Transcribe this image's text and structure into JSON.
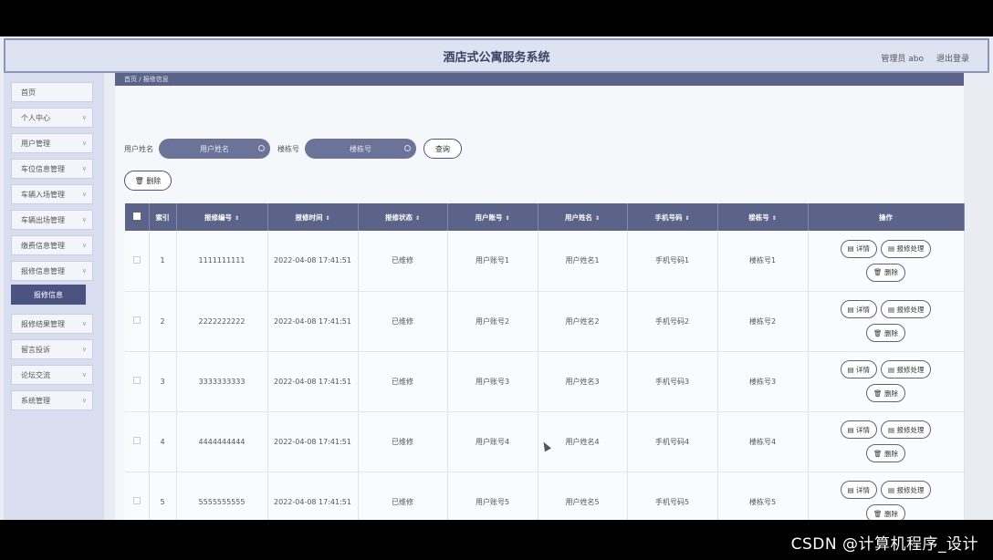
{
  "header": {
    "title": "酒店式公寓服务系统",
    "user": "管理员 abo",
    "logout": "退出登录"
  },
  "sidebar": {
    "items": [
      {
        "label": "首页",
        "has_chevron": false
      },
      {
        "label": "个人中心",
        "has_chevron": true
      },
      {
        "label": "用户管理",
        "has_chevron": true
      },
      {
        "label": "车位信息管理",
        "has_chevron": true
      },
      {
        "label": "车辆入场管理",
        "has_chevron": true
      },
      {
        "label": "车辆出场管理",
        "has_chevron": true
      },
      {
        "label": "缴费信息管理",
        "has_chevron": true
      },
      {
        "label": "报修信息管理",
        "has_chevron": true
      }
    ],
    "active_sub": "报修信息",
    "items_after": [
      {
        "label": "报修结果管理"
      },
      {
        "label": "留言投诉"
      },
      {
        "label": "论坛交流"
      },
      {
        "label": "系统管理"
      }
    ]
  },
  "breadcrumb": "首页 / 报修信息",
  "search": {
    "name_label": "用户姓名",
    "name_placeholder": "用户姓名",
    "building_label": "楼栋号",
    "building_placeholder": "楼栋号",
    "query_label": "查询"
  },
  "toolbar": {
    "delete_label": "删除"
  },
  "table": {
    "headers": [
      "索引",
      "报修编号",
      "报修时间",
      "报修状态",
      "用户账号",
      "用户姓名",
      "手机号码",
      "楼栋号",
      "操作"
    ],
    "rows": [
      [
        "1",
        "1111111111",
        "2022-04-08 17:41:51",
        "已维修",
        "用户账号1",
        "用户姓名1",
        "手机号码1",
        "楼栋号1"
      ],
      [
        "2",
        "2222222222",
        "2022-04-08 17:41:51",
        "已维修",
        "用户账号2",
        "用户姓名2",
        "手机号码2",
        "楼栋号2"
      ],
      [
        "3",
        "3333333333",
        "2022-04-08 17:41:51",
        "已维修",
        "用户账号3",
        "用户姓名3",
        "手机号码3",
        "楼栋号3"
      ],
      [
        "4",
        "4444444444",
        "2022-04-08 17:41:51",
        "已维修",
        "用户账号4",
        "用户姓名4",
        "手机号码4",
        "楼栋号4"
      ],
      [
        "5",
        "5555555555",
        "2022-04-08 17:41:51",
        "已维修",
        "用户账号5",
        "用户姓名5",
        "手机号码5",
        "楼栋号5"
      ]
    ],
    "row_actions": {
      "detail": "详情",
      "repair": "报修处理",
      "delete": "删除"
    }
  },
  "watermark": "CSDN @计算机程序_设计"
}
